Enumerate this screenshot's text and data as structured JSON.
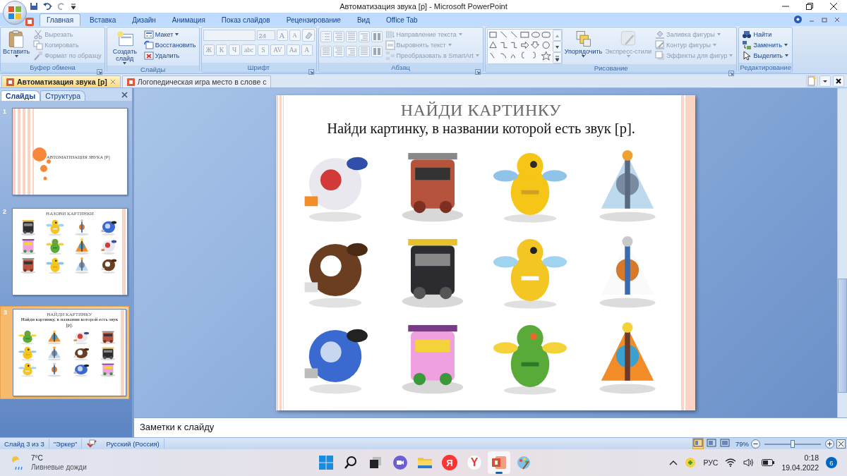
{
  "window": {
    "title": "Автоматизация звука [р] - Microsoft PowerPoint"
  },
  "ribbon_tabs": [
    {
      "label": "Главная",
      "selected": true
    },
    {
      "label": "Вставка",
      "selected": false
    },
    {
      "label": "Дизайн",
      "selected": false
    },
    {
      "label": "Анимация",
      "selected": false
    },
    {
      "label": "Показ слайдов",
      "selected": false
    },
    {
      "label": "Рецензирование",
      "selected": false
    },
    {
      "label": "Вид",
      "selected": false
    },
    {
      "label": "Office Tab",
      "selected": false
    }
  ],
  "ribbon_groups": [
    {
      "kind": "clipboard",
      "label": "Буфер обмена",
      "items": [
        {
          "kind": "large",
          "label": "Вставить",
          "disabled": false,
          "dropdown": true
        },
        {
          "kind": "small",
          "label": "Вырезать",
          "disabled": true,
          "dropdown": false
        },
        {
          "kind": "small",
          "label": "Копировать",
          "disabled": true,
          "dropdown": false
        },
        {
          "kind": "small",
          "label": "Формат по образцу",
          "disabled": true,
          "dropdown": false
        }
      ]
    },
    {
      "kind": "slides",
      "label": "Слайды",
      "items": [
        {
          "kind": "large",
          "label": "Создать слайд",
          "disabled": false,
          "dropdown": true
        },
        {
          "kind": "small",
          "label": "Макет",
          "disabled": false,
          "dropdown": true
        },
        {
          "kind": "small",
          "label": "Восстановить",
          "disabled": false,
          "dropdown": false
        },
        {
          "kind": "small",
          "label": "Удалить",
          "disabled": false,
          "dropdown": false
        }
      ]
    },
    {
      "kind": "font",
      "label": "Шрифт",
      "size_field": {
        "value": "24",
        "disabled": true
      },
      "size_buttons": [
        {
          "label": "A",
          "disabled": true
        },
        {
          "label": "A",
          "disabled": true
        }
      ],
      "format_buttons": [
        {
          "label": "Ж",
          "disabled": true
        },
        {
          "label": "К",
          "disabled": true
        },
        {
          "label": "Ч",
          "disabled": true
        },
        {
          "label": "abc",
          "disabled": true
        },
        {
          "label": "S",
          "disabled": true
        },
        {
          "label": "AV",
          "disabled": true
        },
        {
          "label": "Aa",
          "disabled": true
        },
        {
          "label": "A",
          "disabled": true
        }
      ]
    },
    {
      "kind": "paragraph",
      "label": "Абзац",
      "items": [
        {
          "kind": "small",
          "label": "Направление текста",
          "disabled": true,
          "dropdown": true
        },
        {
          "kind": "small",
          "label": "Выровнять текст",
          "disabled": true,
          "dropdown": true
        },
        {
          "kind": "small",
          "label": "Преобразовать в SmartArt",
          "disabled": true,
          "dropdown": true
        }
      ]
    },
    {
      "kind": "drawing",
      "label": "Рисование",
      "items": [
        {
          "kind": "large",
          "label": "Упорядочить",
          "disabled": false,
          "dropdown": true
        },
        {
          "kind": "large",
          "label": "Экспресс-стили",
          "disabled": true,
          "dropdown": true
        },
        {
          "kind": "small",
          "label": "Заливка фигуры",
          "disabled": true,
          "dropdown": true
        },
        {
          "kind": "small",
          "label": "Контур фигуры",
          "disabled": true,
          "dropdown": true
        },
        {
          "kind": "small",
          "label": "Эффекты для фигур",
          "disabled": true,
          "dropdown": true
        }
      ]
    },
    {
      "kind": "editing",
      "label": "Редактирование",
      "items": [
        {
          "kind": "small",
          "label": "Найти",
          "disabled": false,
          "dropdown": false
        },
        {
          "kind": "small",
          "label": "Заменить",
          "disabled": false,
          "dropdown": true
        },
        {
          "kind": "small",
          "label": "Выделить",
          "disabled": false,
          "dropdown": true
        }
      ]
    }
  ],
  "document_tabs": [
    {
      "label": "Автоматизация звука [р]",
      "selected": true
    },
    {
      "label": "Логопедическая игра место в слове с",
      "selected": false
    }
  ],
  "panel_tabs": [
    {
      "label": "Слайды",
      "selected": true
    },
    {
      "label": "Структура",
      "selected": false
    }
  ],
  "thumbnails": [
    {
      "number": "1",
      "kind": "title",
      "selected": false,
      "title": "АВТОМАТИЗАЦИЯ ЗВУКА [Р]"
    },
    {
      "number": "2",
      "kind": "pictures",
      "selected": false,
      "title": "НАЗОВИ КАРТИНКИ"
    },
    {
      "number": "3",
      "kind": "pictures",
      "selected": true,
      "title": "НАЙДИ КАРТИНКУ",
      "subtitle": "Найди картинку, в названии которой есть звук [р]."
    }
  ],
  "slide": {
    "title": "НАЙДИ КАРТИНКУ",
    "subtitle": "Найди картинку, в названии которой есть звук [р]."
  },
  "notes": {
    "text": "Заметки к слайду"
  },
  "status_bar": {
    "slide": "Слайд 3 из 3",
    "theme": "\"Эркер\"",
    "language": "Русский (Россия)",
    "views": [
      {
        "selected": true
      },
      {
        "selected": false
      },
      {
        "selected": false
      }
    ],
    "zoom": "79%",
    "zoom_slider": {
      "level": 0.5
    }
  },
  "taskbar": {
    "weather": {
      "temperature": "7°C",
      "condition": "Ливневые дожди"
    },
    "apps": [
      {
        "kind": "start",
        "active": false
      },
      {
        "kind": "search",
        "active": false
      },
      {
        "kind": "taskview",
        "active": false
      },
      {
        "kind": "chat",
        "active": false
      },
      {
        "kind": "folder",
        "active": false
      },
      {
        "kind": "yandex",
        "label": "Я",
        "active": false
      },
      {
        "kind": "browser",
        "label": "Y",
        "active": false
      },
      {
        "kind": "powerpoint",
        "active": true
      },
      {
        "kind": "paint",
        "active": false
      }
    ],
    "language": "РУС",
    "time": "0:18",
    "date": "19.04.2022",
    "notifications": "6"
  }
}
